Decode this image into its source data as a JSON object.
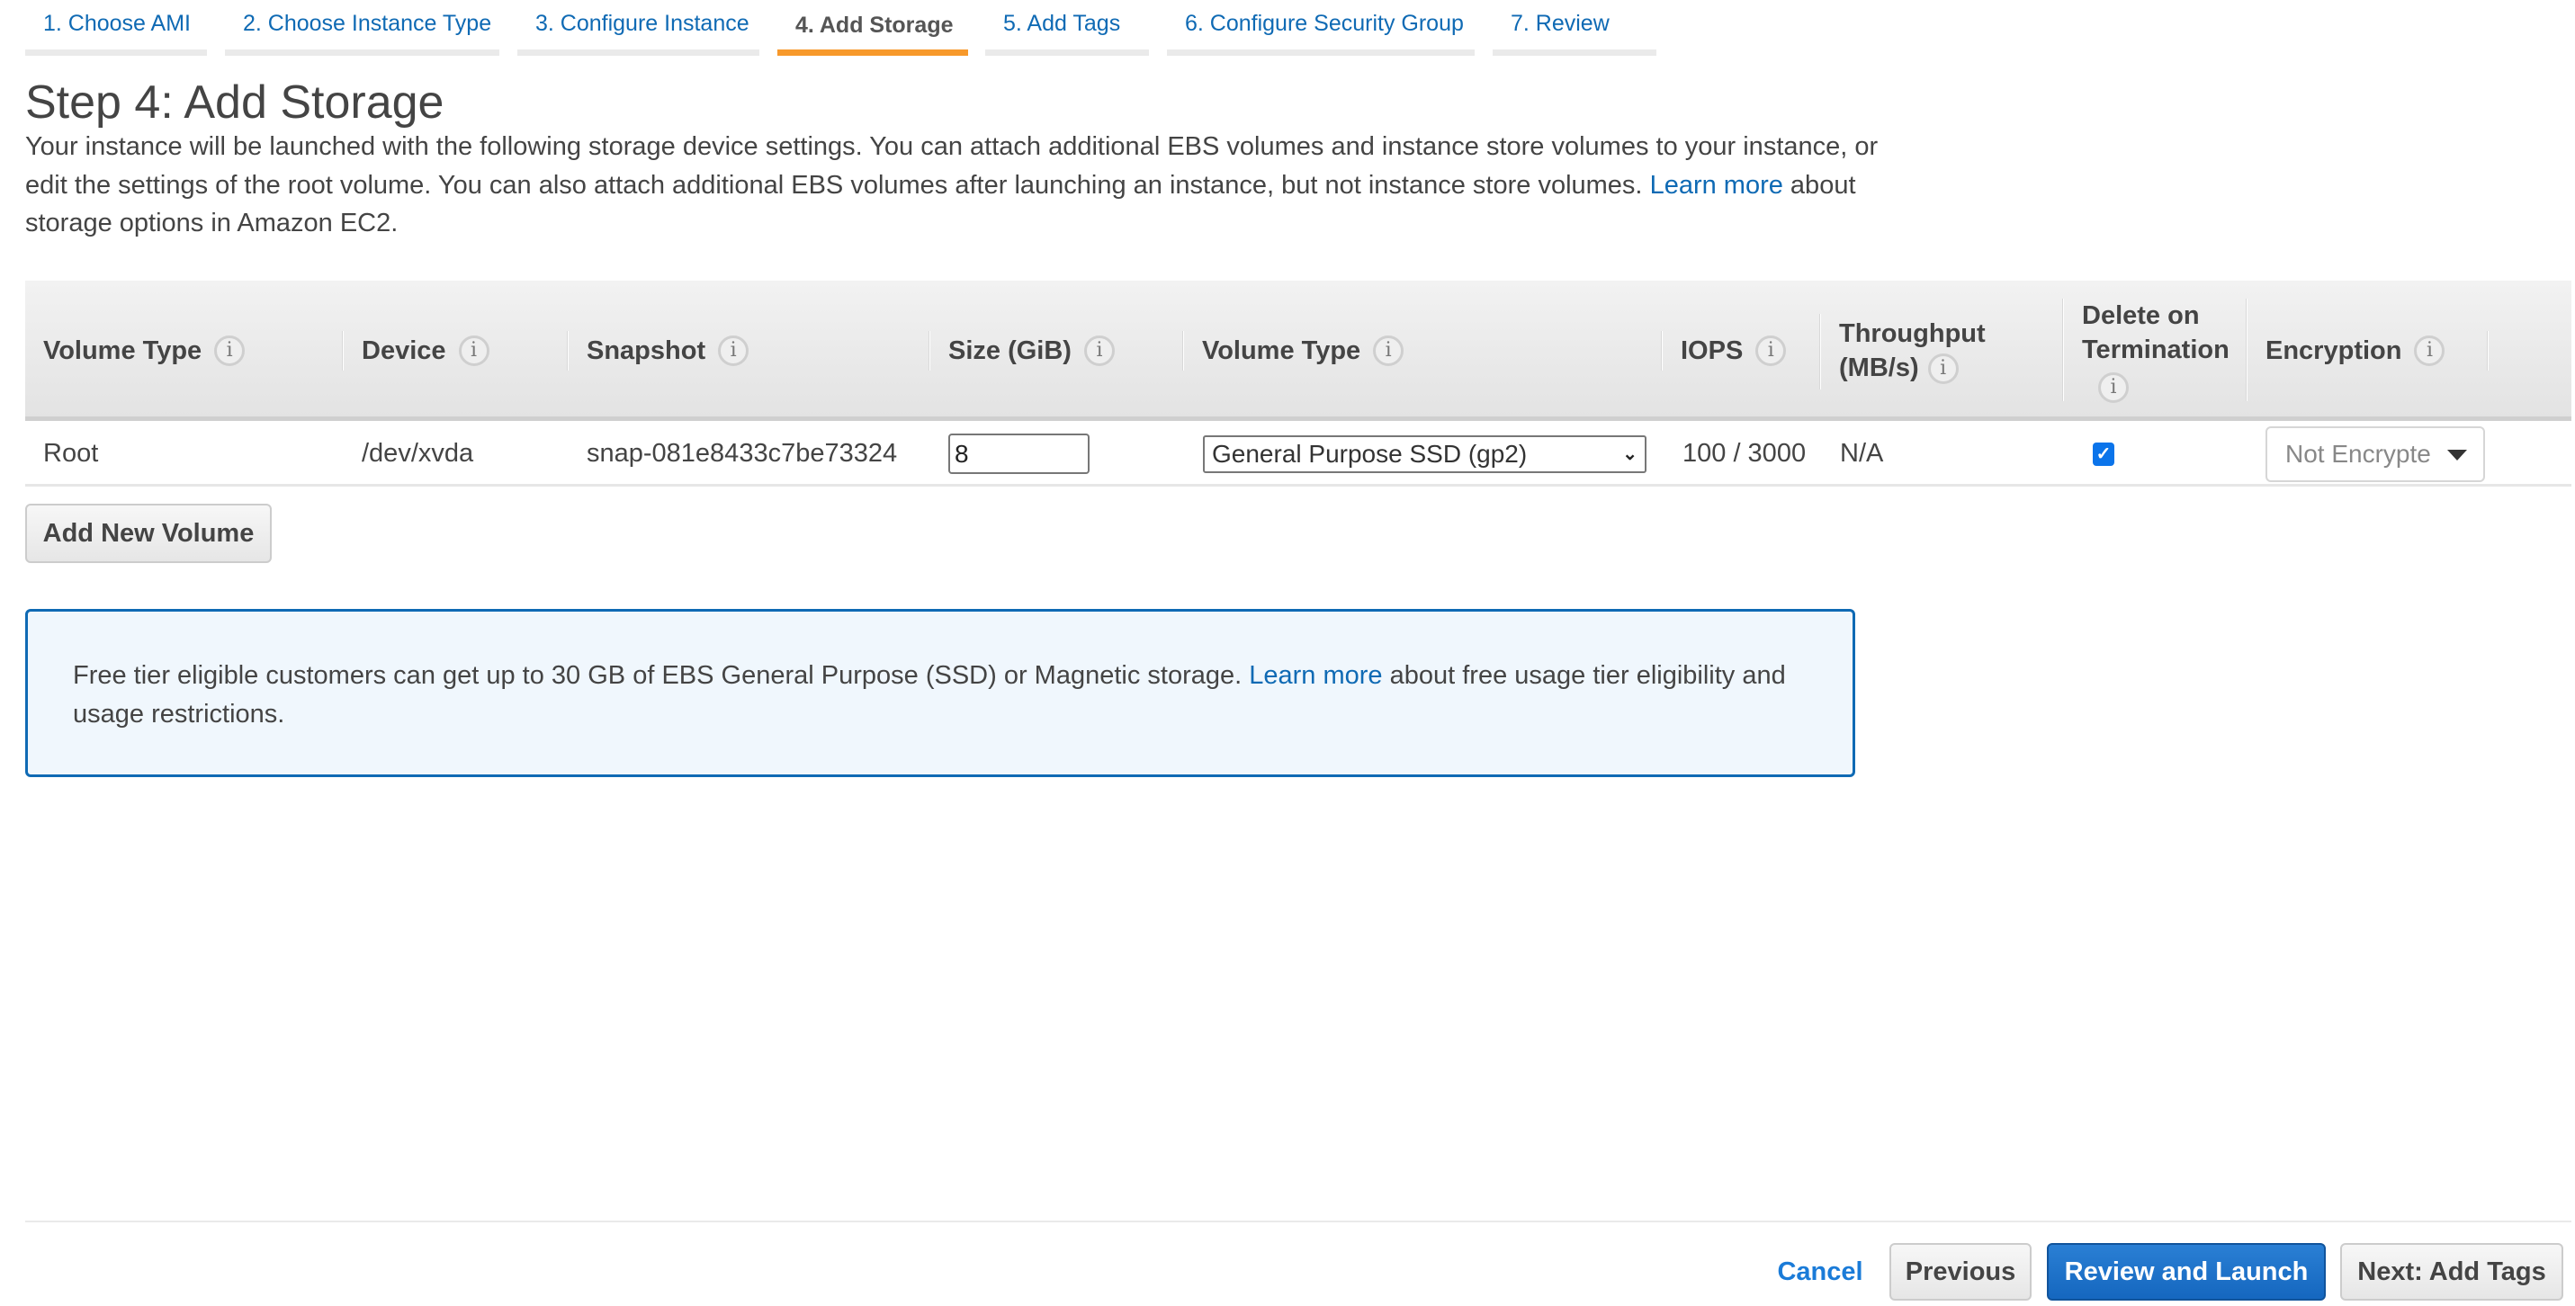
{
  "tabs": [
    {
      "label": "1. Choose AMI",
      "active": false
    },
    {
      "label": "2. Choose Instance Type",
      "active": false
    },
    {
      "label": "3. Configure Instance",
      "active": false
    },
    {
      "label": "4. Add Storage",
      "active": true
    },
    {
      "label": "5. Add Tags",
      "active": false
    },
    {
      "label": "6. Configure Security Group",
      "active": false
    },
    {
      "label": "7. Review",
      "active": false
    }
  ],
  "page": {
    "title": "Step 4: Add Storage",
    "intro_before_link": "Your instance will be launched with the following storage device settings. You can attach additional EBS volumes and instance store volumes to your instance, or edit the settings of the root volume. You can also attach additional EBS volumes after launching an instance, but not instance store volumes. ",
    "intro_link": "Learn more",
    "intro_after_link": " about storage options in Amazon EC2."
  },
  "table": {
    "headers": [
      {
        "label": "Volume Type"
      },
      {
        "label": "Device"
      },
      {
        "label": "Snapshot"
      },
      {
        "label": "Size (GiB)"
      },
      {
        "label": "Volume Type"
      },
      {
        "label": "IOPS"
      },
      {
        "label": "Throughput (MB/s)"
      },
      {
        "label": "Delete on Termination"
      },
      {
        "label": "Encryption"
      }
    ],
    "info_icon": "i",
    "rows": [
      {
        "volume_type": "Root",
        "device": "/dev/xvda",
        "snapshot": "snap-081e8433c7be73324",
        "size": "8",
        "ebs_volume_type": "General Purpose SSD (gp2)",
        "iops": "100 / 3000",
        "throughput": "N/A",
        "delete_on_termination": true,
        "encryption": "Not Encrypted"
      }
    ]
  },
  "buttons": {
    "add_new_volume": "Add New Volume",
    "cancel": "Cancel",
    "previous": "Previous",
    "review_and_launch": "Review and Launch",
    "next": "Next: Add Tags"
  },
  "free_tier": {
    "text_before_link": "Free tier eligible customers can get up to 30 GB of EBS General Purpose (SSD) or Magnetic storage. ",
    "link": "Learn more",
    "text_after_link": " about free usage tier eligibility and usage restrictions."
  },
  "icons": {
    "info": "info-circle-icon",
    "select_chevron": "⌄",
    "checkmark": "✓"
  },
  "colors": {
    "link": "#0f6ab4",
    "active_tab_underline": "#f7992b",
    "primary_button": "#1a6fc9",
    "infobox_border": "#0f6ab4",
    "infobox_bg": "#f0f7fd"
  }
}
